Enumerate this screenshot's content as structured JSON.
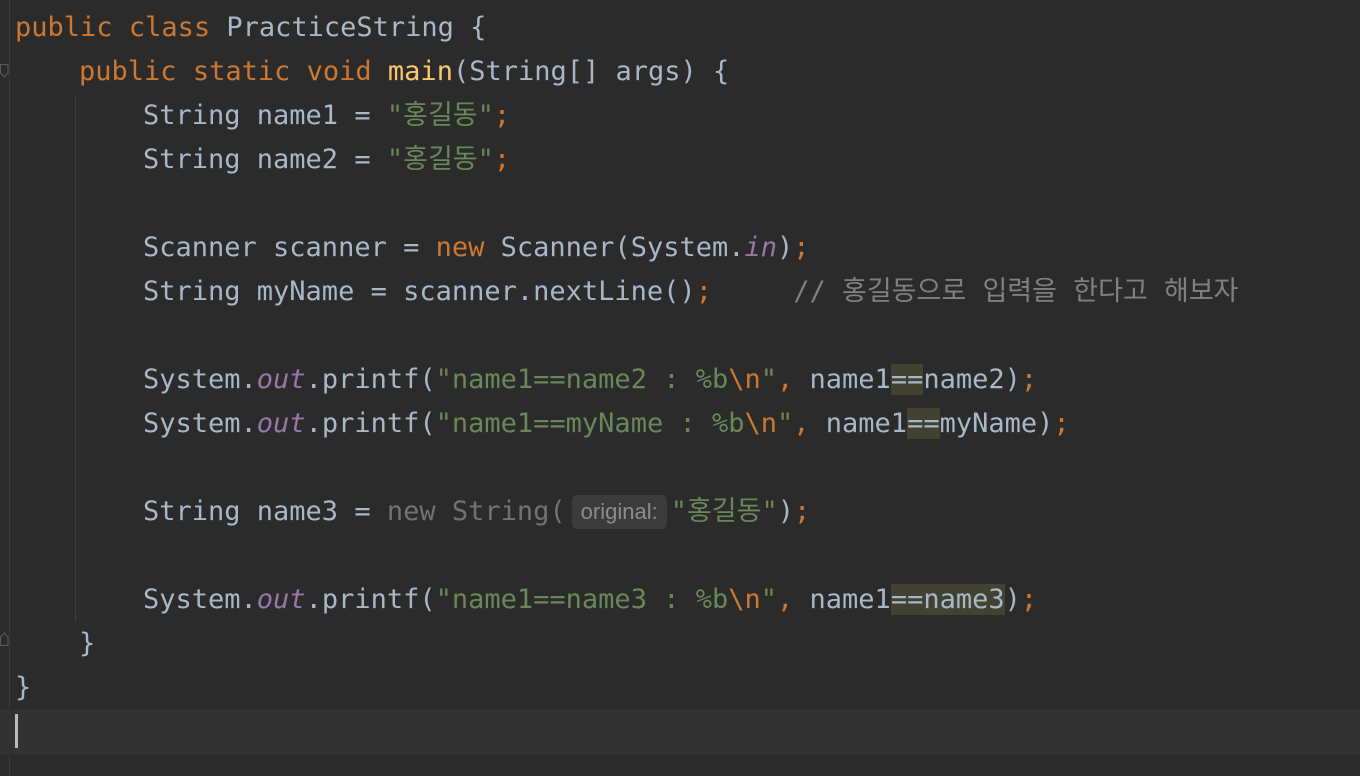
{
  "editor": {
    "lines": {
      "class_decl": {
        "public": "public",
        "class": "class",
        "name": " PracticeString {"
      },
      "main_decl": {
        "public": "public",
        "static": "static",
        "void": "void",
        "main": "main",
        "params": "(String[] args) {"
      },
      "name1": {
        "type": "String name1 = ",
        "value": "\"홍길동\"",
        "semi": ";"
      },
      "name2": {
        "type": "String name2 = ",
        "value": "\"홍길동\"",
        "semi": ";"
      },
      "scanner": {
        "left": "Scanner scanner = ",
        "new": "new",
        "call": " Scanner(System.",
        "field": "in",
        "close": ")",
        "semi": ";"
      },
      "myname": {
        "code": "String myName = scanner.nextLine()",
        "semi": ";",
        "comment": "// 홍길동으로 입력을 한다고 해보자"
      },
      "print1": {
        "obj": "System.",
        "out": "out",
        "method": ".printf(",
        "str": "\"name1==name2 : %b",
        "esc": "\\n",
        "strend": "\"",
        "comma": ",",
        "a": " name1",
        "op": "==",
        "b": "name2",
        "close": ")",
        "semi": ";"
      },
      "print2": {
        "obj": "System.",
        "out": "out",
        "method": ".printf(",
        "str": "\"name1==myName : %b",
        "esc": "\\n",
        "strend": "\"",
        "comma": ",",
        "a": " name1",
        "op": "==",
        "b": "myName",
        "close": ")",
        "semi": ";"
      },
      "name3": {
        "left": "String name3 = ",
        "new": "new String(",
        "hint": "original:",
        "value": "\"홍길동\"",
        "close": ")",
        "semi": ";"
      },
      "print3": {
        "obj": "System.",
        "out": "out",
        "method": ".printf(",
        "str": "\"name1==name3 : %b",
        "esc": "\\n",
        "strend": "\"",
        "comma": ",",
        "a": " name1",
        "op": "==",
        "b": "name3",
        "close": ")",
        "semi": ";"
      },
      "close_method": "}",
      "close_class": "}"
    }
  }
}
